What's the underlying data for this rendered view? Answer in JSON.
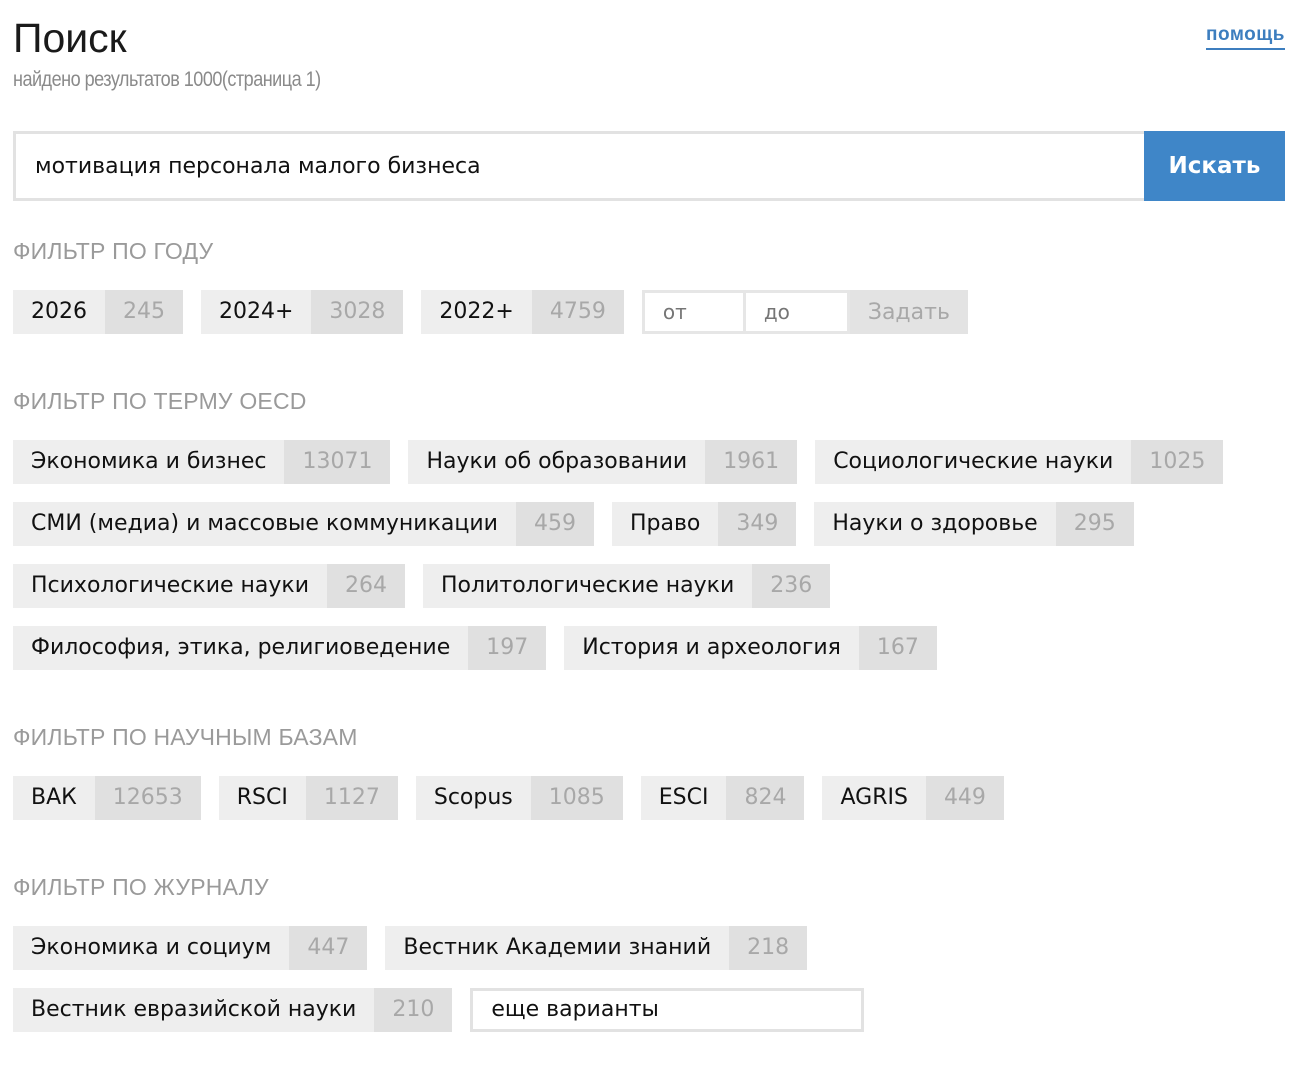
{
  "header": {
    "title": "Поиск",
    "subtitle": "найдено результатов 1000(страница 1)",
    "help_label": "помощь"
  },
  "search": {
    "query": "мотивация персонала малого бизнеса",
    "button_label": "Искать"
  },
  "year_filter": {
    "title": "ФИЛЬТР ПО ГОДУ",
    "chips": [
      {
        "label": "2026",
        "count": "245"
      },
      {
        "label": "2024+",
        "count": "3028"
      },
      {
        "label": "2022+",
        "count": "4759"
      }
    ],
    "from_placeholder": "от",
    "to_placeholder": "до",
    "submit_label": "Задать"
  },
  "oecd_filter": {
    "title": "ФИЛЬТР ПО ТЕРМУ OECD",
    "chips": [
      {
        "label": "Экономика и бизнес",
        "count": "13071"
      },
      {
        "label": "Науки об образовании",
        "count": "1961"
      },
      {
        "label": "Социологические науки",
        "count": "1025"
      },
      {
        "label": "СМИ (медиа) и массовые коммуникации",
        "count": "459"
      },
      {
        "label": "Право",
        "count": "349"
      },
      {
        "label": "Науки о здоровье",
        "count": "295"
      },
      {
        "label": "Психологические науки",
        "count": "264"
      },
      {
        "label": "Политологические науки",
        "count": "236"
      },
      {
        "label": "Философия, этика, религиоведение",
        "count": "197"
      },
      {
        "label": "История и археология",
        "count": "167"
      }
    ]
  },
  "db_filter": {
    "title": "ФИЛЬТР ПО НАУЧНЫМ БАЗАМ",
    "chips": [
      {
        "label": "ВАК",
        "count": "12653"
      },
      {
        "label": "RSCI",
        "count": "1127"
      },
      {
        "label": "Scopus",
        "count": "1085"
      },
      {
        "label": "ESCI",
        "count": "824"
      },
      {
        "label": "AGRIS",
        "count": "449"
      }
    ]
  },
  "journal_filter": {
    "title": "ФИЛЬТР ПО ЖУРНАЛУ",
    "chips": [
      {
        "label": "Экономика и социум",
        "count": "447"
      },
      {
        "label": "Вестник Академии знаний",
        "count": "218"
      },
      {
        "label": "Вестник евразийской науки",
        "count": "210"
      }
    ],
    "more_label": "еще варианты"
  }
}
